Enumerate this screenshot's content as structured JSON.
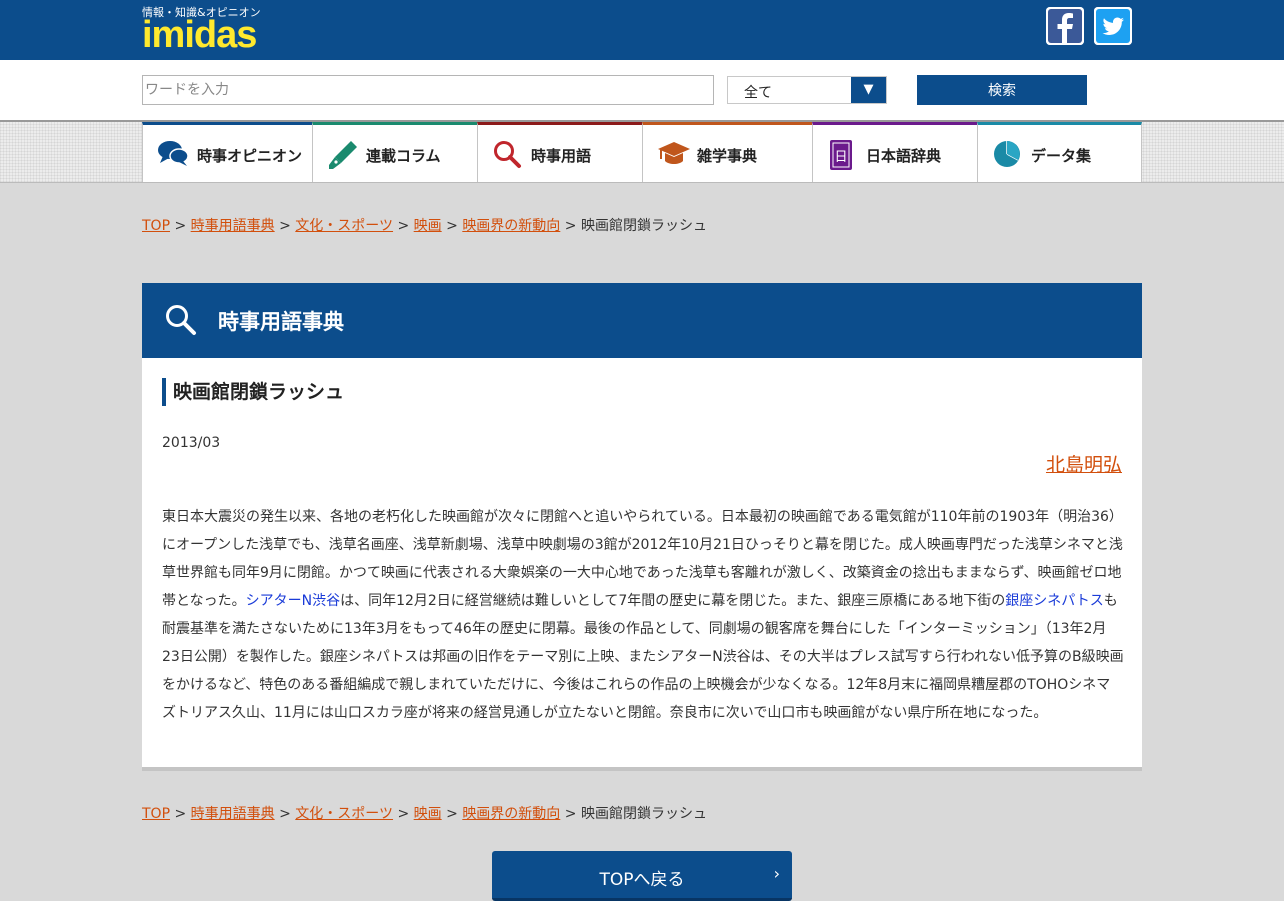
{
  "header": {
    "tagline": "情報・知識&オピニオン",
    "logo_text": "imidas",
    "colors": {
      "brand_blue": "#0c4d8c",
      "logo_yellow": "#ffe92e",
      "link_orange": "#d24f0c"
    }
  },
  "search": {
    "placeholder": "ワードを入力",
    "value": "",
    "category_selected": "全て",
    "button_label": "検索"
  },
  "nav": {
    "items": [
      {
        "label": "時事オピニオン",
        "icon": "speech-bubbles-icon",
        "accent": "#0c4d8c"
      },
      {
        "label": "連載コラム",
        "icon": "fountain-pen-icon",
        "accent": "#1a8a6e"
      },
      {
        "label": "時事用語",
        "icon": "magnifier-icon",
        "accent": "#8c1a1a"
      },
      {
        "label": "雑学事典",
        "icon": "graduation-cap-icon",
        "accent": "#c0561c"
      },
      {
        "label": "日本語辞典",
        "icon": "dictionary-book-icon",
        "accent": "#6b1a8c"
      },
      {
        "label": "データ集",
        "icon": "pie-chart-icon",
        "accent": "#1a8aa6"
      }
    ]
  },
  "breadcrumb": {
    "items": [
      "TOP",
      "時事用語事典",
      "文化・スポーツ",
      "映画",
      "映画界の新動向"
    ],
    "separator": ">",
    "current": "映画館閉鎖ラッシュ"
  },
  "section": {
    "title": "時事用語事典"
  },
  "article": {
    "title": "映画館閉鎖ラッシュ",
    "date": "2013/03",
    "author": "北島明弘",
    "body_part1": "東日本大震災の発生以来、各地の老朽化した映画館が次々に閉館へと追いやられている。日本最初の映画館である電気館が110年前の1903年（明治36）にオープンした浅草でも、浅草名画座、浅草新劇場、浅草中映劇場の3館が2012年10月21日ひっそりと幕を閉じた。成人映画専門だった浅草シネマと浅草世界館も同年9月に閉館。かつて映画に代表される大衆娯楽の一大中心地であった浅草も客離れが激しく、改築資金の捻出もままならず、映画館ゼロ地帯となった。",
    "link1": "シアターN渋谷",
    "body_part2": "は、同年12月2日に経営継続は難しいとして7年間の歴史に幕を閉じた。また、銀座三原橋にある地下街の",
    "link2": "銀座シネパトス",
    "body_part3": "も耐震基準を満たさないために13年3月をもって46年の歴史に閉幕。最後の作品として、同劇場の観客席を舞台にした「インターミッション」（13年2月23日公開）を製作した。銀座シネパトスは邦画の旧作をテーマ別に上映、またシアターN渋谷は、その大半はプレス試写すら行われない低予算のB級映画をかけるなど、特色のある番組編成で親しまれていただけに、今後はこれらの作品の上映機会が少なくなる。12年8月末に福岡県糟屋郡のTOHOシネマズトリアス久山、11月には山口スカラ座が将来の経営見通しが立たないと閉館。奈良市に次いで山口市も映画館がない県庁所在地になった。"
  },
  "footer": {
    "top_button_label": "TOPへ戻る",
    "top_button_chevron": "›"
  }
}
